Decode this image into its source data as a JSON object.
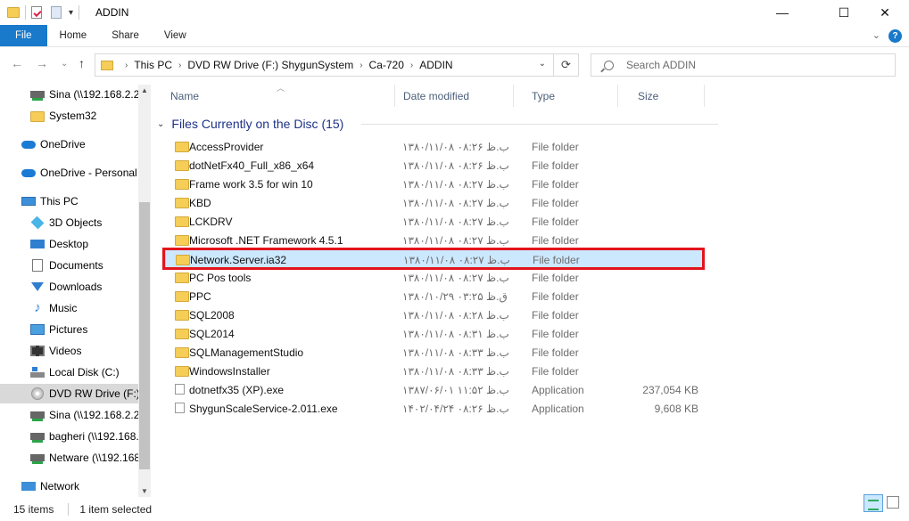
{
  "window": {
    "title": "ADDIN",
    "minimize": "—",
    "maximize": "☐",
    "close": "✕"
  },
  "ribbon": {
    "tabs": [
      "File",
      "Home",
      "Share",
      "View"
    ],
    "expand": "⌄",
    "help": "?"
  },
  "address": {
    "back": "←",
    "forward": "→",
    "recent": "⌄",
    "up": "↑",
    "crumbs": [
      "This PC",
      "DVD RW Drive (F:) ShygunSystem",
      "Ca-720",
      "ADDIN"
    ],
    "refresh": "⟳",
    "search_placeholder": "Search ADDIN"
  },
  "nav": {
    "items": [
      {
        "label": "Sina (\\\\192.168.2.2\\",
        "icon": "network-drive-icon"
      },
      {
        "label": "System32",
        "icon": "folder-icon"
      },
      {
        "label": "OneDrive",
        "icon": "onedrive-icon"
      },
      {
        "label": "OneDrive - Personal",
        "icon": "onedrive-icon"
      },
      {
        "label": "This PC",
        "icon": "this-pc-icon"
      },
      {
        "label": "3D Objects",
        "icon": "3d-objects-icon"
      },
      {
        "label": "Desktop",
        "icon": "desktop-icon"
      },
      {
        "label": "Documents",
        "icon": "documents-icon"
      },
      {
        "label": "Downloads",
        "icon": "downloads-icon"
      },
      {
        "label": "Music",
        "icon": "music-icon"
      },
      {
        "label": "Pictures",
        "icon": "pictures-icon"
      },
      {
        "label": "Videos",
        "icon": "videos-icon"
      },
      {
        "label": "Local Disk (C:)",
        "icon": "local-disk-icon"
      },
      {
        "label": "DVD RW Drive (F:) S",
        "icon": "dvd-drive-icon"
      },
      {
        "label": "Sina (\\\\192.168.2.2\\",
        "icon": "network-drive-icon"
      },
      {
        "label": "bagheri (\\\\192.168.",
        "icon": "network-drive-icon"
      },
      {
        "label": "Netware (\\\\192.168",
        "icon": "network-drive-icon"
      },
      {
        "label": "Network",
        "icon": "network-icon"
      }
    ],
    "selected_index": 13
  },
  "columns": {
    "name": "Name",
    "date": "Date modified",
    "type": "Type",
    "size": "Size"
  },
  "group": {
    "title": "Files Currently on the Disc (15)",
    "chevron": "⌄"
  },
  "files": [
    {
      "name": "AccessProvider",
      "date": "۱۳۸۰/۱۱/۰۸ ب.ظ ۰۸:۲۶",
      "type": "File folder",
      "size": "",
      "icon": "folder-icon"
    },
    {
      "name": "dotNetFx40_Full_x86_x64",
      "date": "۱۳۸۰/۱۱/۰۸ ب.ظ ۰۸:۲۶",
      "type": "File folder",
      "size": "",
      "icon": "folder-icon"
    },
    {
      "name": "Frame work 3.5 for win 10",
      "date": "۱۳۸۰/۱۱/۰۸ ب.ظ ۰۸:۲۷",
      "type": "File folder",
      "size": "",
      "icon": "folder-icon"
    },
    {
      "name": "KBD",
      "date": "۱۳۸۰/۱۱/۰۸ ب.ظ ۰۸:۲۷",
      "type": "File folder",
      "size": "",
      "icon": "folder-icon"
    },
    {
      "name": "LCKDRV",
      "date": "۱۳۸۰/۱۱/۰۸ ب.ظ ۰۸:۲۷",
      "type": "File folder",
      "size": "",
      "icon": "folder-icon"
    },
    {
      "name": "Microsoft .NET Framework 4.5.1",
      "date": "۱۳۸۰/۱۱/۰۸ ب.ظ ۰۸:۲۷",
      "type": "File folder",
      "size": "",
      "icon": "folder-icon"
    },
    {
      "name": "Network.Server.ia32",
      "date": "۱۳۸۰/۱۱/۰۸ ب.ظ ۰۸:۲۷",
      "type": "File folder",
      "size": "",
      "icon": "folder-icon"
    },
    {
      "name": "PC Pos tools",
      "date": "۱۳۸۰/۱۱/۰۸ ب.ظ ۰۸:۲۷",
      "type": "File folder",
      "size": "",
      "icon": "folder-icon"
    },
    {
      "name": "PPC",
      "date": "۱۳۸۰/۱۰/۲۹ ق.ظ ۰۳:۲۵",
      "type": "File folder",
      "size": "",
      "icon": "folder-icon"
    },
    {
      "name": "SQL2008",
      "date": "۱۳۸۰/۱۱/۰۸ ب.ظ ۰۸:۲۸",
      "type": "File folder",
      "size": "",
      "icon": "folder-icon"
    },
    {
      "name": "SQL2014",
      "date": "۱۳۸۰/۱۱/۰۸ ب.ظ ۰۸:۳۱",
      "type": "File folder",
      "size": "",
      "icon": "folder-icon"
    },
    {
      "name": "SQLManagementStudio",
      "date": "۱۳۸۰/۱۱/۰۸ ب.ظ ۰۸:۳۳",
      "type": "File folder",
      "size": "",
      "icon": "folder-icon"
    },
    {
      "name": "WindowsInstaller",
      "date": "۱۳۸۰/۱۱/۰۸ ب.ظ ۰۸:۳۳",
      "type": "File folder",
      "size": "",
      "icon": "folder-icon"
    },
    {
      "name": "dotnetfx35 (XP).exe",
      "date": "۱۳۸۷/۰۶/۰۱ ب.ظ ۱۱:۵۲",
      "type": "Application",
      "size": "237,054 KB",
      "icon": "file-icon"
    },
    {
      "name": "ShygunScaleService-2.011.exe",
      "date": "۱۴۰۲/۰۴/۲۴ ب.ظ ۰۸:۲۶",
      "type": "Application",
      "size": "9,608 KB",
      "icon": "exe-icon"
    }
  ],
  "selected_file_index": 6,
  "status": {
    "count": "15 items",
    "selected": "1 item selected"
  },
  "colors": {
    "accent": "#1979ca",
    "selection_bg": "#cce8ff",
    "highlight_border": "#e3141d",
    "group_title": "#1e3287"
  }
}
